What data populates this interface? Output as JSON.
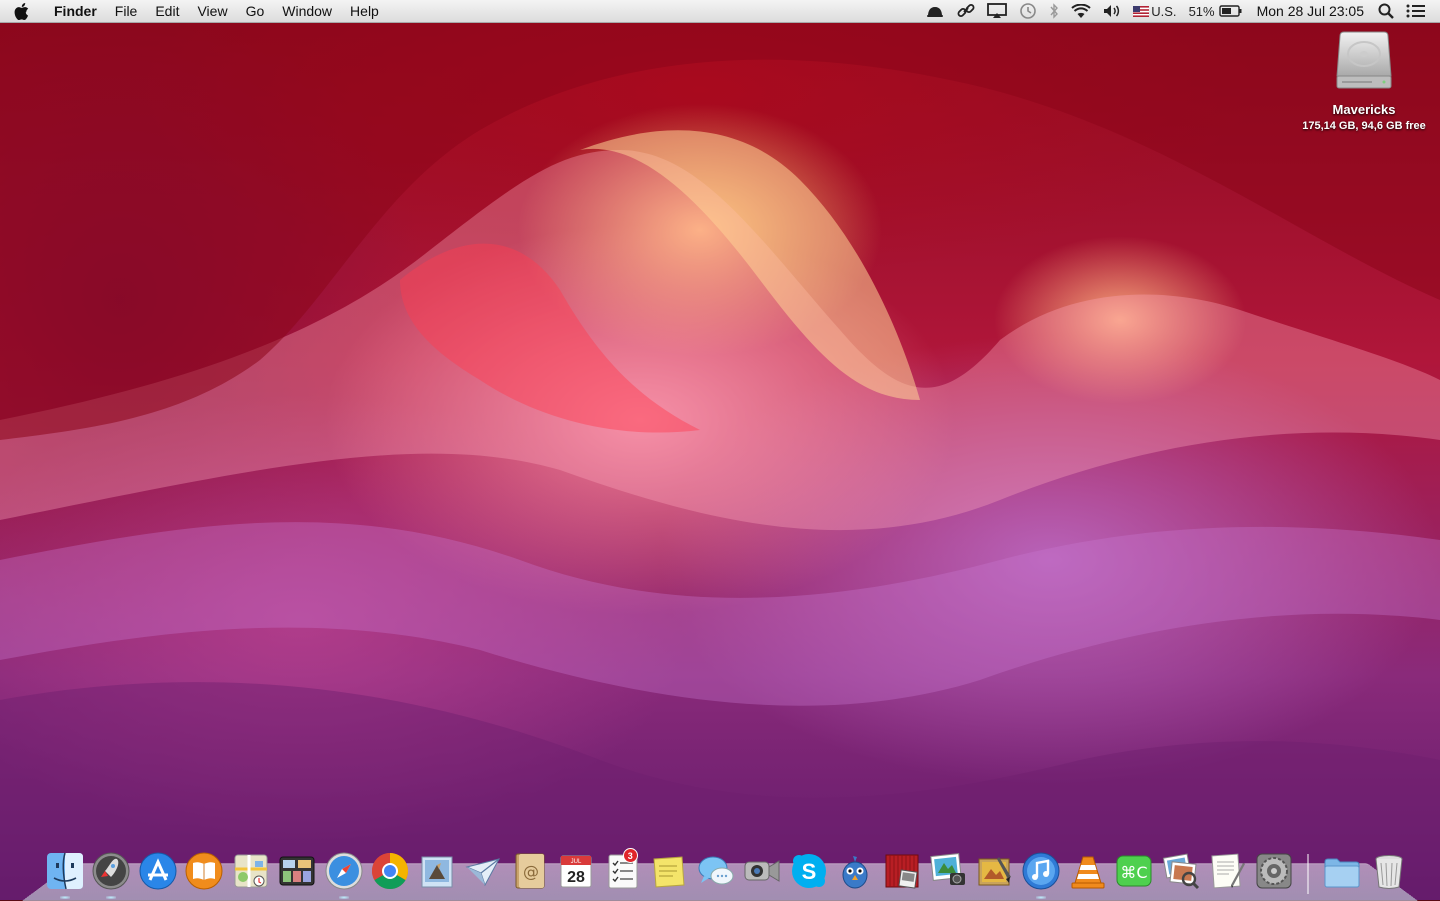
{
  "menubar": {
    "app_name": "Finder",
    "menus": [
      "File",
      "Edit",
      "View",
      "Go",
      "Window",
      "Help"
    ],
    "status_items": {
      "input_source": "U.S.",
      "battery_percent": "51%",
      "clock": "Mon 28 Jul  23:05"
    }
  },
  "desktop": {
    "drive": {
      "name": "Mavericks",
      "info": "175,14 GB, 94,6 GB free"
    }
  },
  "dock": {
    "badge_reminders": "3",
    "calendar_day": "28",
    "calendar_month": "JUL",
    "items": [
      {
        "name": "Finder",
        "icon": "finder-icon"
      },
      {
        "name": "Launchpad",
        "icon": "launchpad-icon"
      },
      {
        "name": "App Store",
        "icon": "app-store-icon"
      },
      {
        "name": "iBooks",
        "icon": "ibooks-icon"
      },
      {
        "name": "Maps",
        "icon": "maps-icon"
      },
      {
        "name": "Mission Control",
        "icon": "mission-control-icon"
      },
      {
        "name": "Safari",
        "icon": "safari-icon"
      },
      {
        "name": "Google Chrome",
        "icon": "chrome-icon"
      },
      {
        "name": "Mail",
        "icon": "mail-icon"
      },
      {
        "name": "Sparrow",
        "icon": "sparrow-icon"
      },
      {
        "name": "Contacts",
        "icon": "contacts-icon"
      },
      {
        "name": "Calendar",
        "icon": "calendar-icon"
      },
      {
        "name": "Reminders",
        "icon": "reminders-icon"
      },
      {
        "name": "Stickies",
        "icon": "stickies-icon"
      },
      {
        "name": "Messages",
        "icon": "messages-icon"
      },
      {
        "name": "FaceTime",
        "icon": "facetime-icon"
      },
      {
        "name": "Skype",
        "icon": "skype-icon"
      },
      {
        "name": "Tweetbot",
        "icon": "tweetbot-icon"
      },
      {
        "name": "Photo Booth",
        "icon": "photo-booth-icon"
      },
      {
        "name": "iPhoto",
        "icon": "iphoto-icon"
      },
      {
        "name": "Image Capture",
        "icon": "image-capture-icon"
      },
      {
        "name": "iTunes",
        "icon": "itunes-icon"
      },
      {
        "name": "VLC",
        "icon": "vlc-icon"
      },
      {
        "name": "Cheatsheet",
        "icon": "cheatsheet-icon"
      },
      {
        "name": "Preview",
        "icon": "preview-icon"
      },
      {
        "name": "TextEdit",
        "icon": "textedit-icon"
      },
      {
        "name": "System Preferences",
        "icon": "system-preferences-icon"
      },
      {
        "name": "Documents",
        "icon": "folder-icon"
      },
      {
        "name": "Trash",
        "icon": "trash-icon"
      }
    ]
  },
  "colors": {
    "menubar_bg": "#e8e8e8",
    "badge_red": "#e0242a",
    "wallpaper_red": "#b0163a",
    "wallpaper_purple": "#8a2a7a"
  }
}
